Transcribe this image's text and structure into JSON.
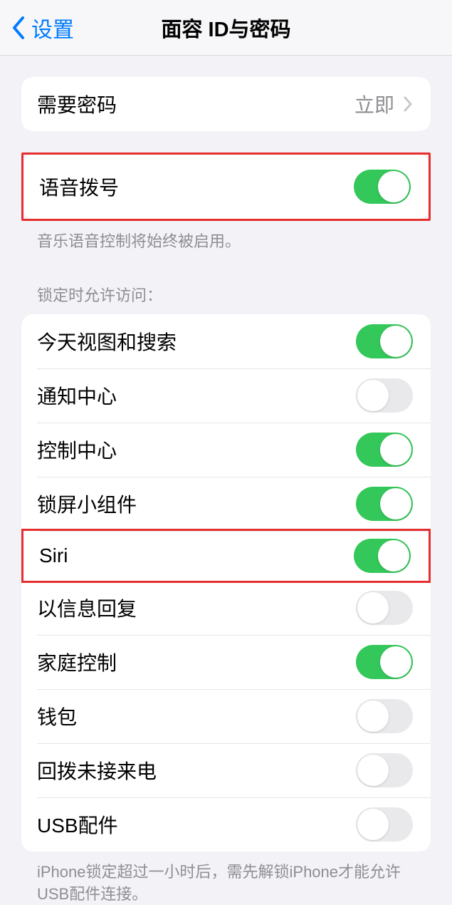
{
  "header": {
    "back_label": "设置",
    "title": "面容 ID与密码"
  },
  "require_passcode": {
    "label": "需要密码",
    "value": "立即"
  },
  "voice_dial": {
    "label": "语音拨号",
    "footer": "音乐语音控制将始终被启用。"
  },
  "locked_access": {
    "header": "锁定时允许访问：",
    "items": {
      "today": {
        "label": "今天视图和搜索",
        "on": true
      },
      "notification": {
        "label": "通知中心",
        "on": false
      },
      "control": {
        "label": "控制中心",
        "on": true
      },
      "widgets": {
        "label": "锁屏小组件",
        "on": true
      },
      "siri": {
        "label": "Siri",
        "on": true
      },
      "reply": {
        "label": "以信息回复",
        "on": false
      },
      "home": {
        "label": "家庭控制",
        "on": true
      },
      "wallet": {
        "label": "钱包",
        "on": false
      },
      "callback": {
        "label": "回拨未接来电",
        "on": false
      },
      "usb": {
        "label": "USB配件",
        "on": false
      }
    },
    "footer": "iPhone锁定超过一小时后，需先解锁iPhone才能允许USB配件连接。"
  }
}
